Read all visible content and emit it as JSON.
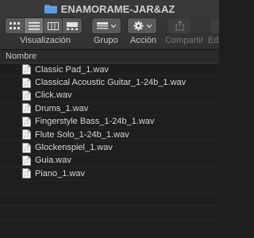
{
  "window": {
    "title": "ENAMORAME-JAR&AZ"
  },
  "toolbar": {
    "view_label": "Visualización",
    "group_label": "Grupo",
    "action_label": "Acción",
    "share_label": "Compartir",
    "edit_label_partial": "Ed"
  },
  "list": {
    "column_header": "Nombre",
    "files": [
      "Classic Pad_1.wav",
      "Classical Acoustic Guitar_1-24b_1.wav",
      "Click.wav",
      "Drums_1.wav",
      "Fingerstyle Bass_1-24b_1.wav",
      "Flute Solo_1-24b_1.wav",
      "Glockenspiel_1.wav",
      "Guia.wav",
      "Piano_1.wav"
    ]
  },
  "colors": {
    "folder": "#4a90d9",
    "toolbar_button": "#5a5a5a",
    "background": "#1e1e1e"
  }
}
